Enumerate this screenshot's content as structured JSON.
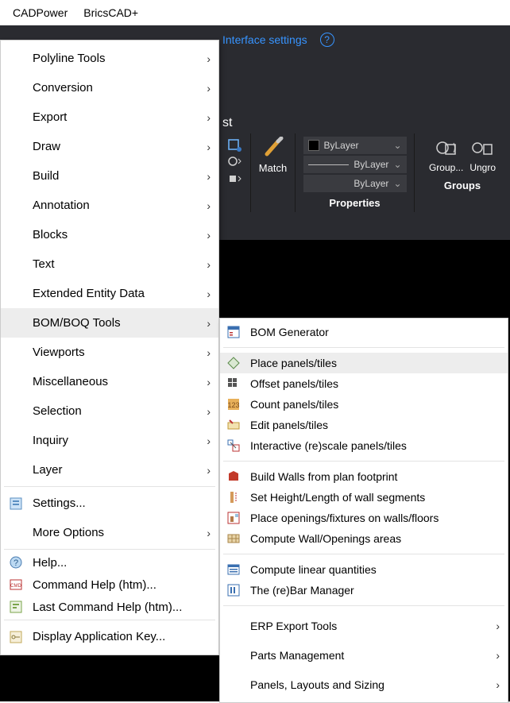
{
  "menubar": {
    "cadpower": "CADPower",
    "bricscad": "BricsCAD+"
  },
  "ribbon": {
    "interface_link": "Interface settings",
    "title_suffix": "st",
    "match": "Match",
    "prop_bylayer": "ByLayer",
    "properties": "Properties",
    "group": "Group...",
    "ungroup": "Ungro",
    "groups": "Groups"
  },
  "menu1": {
    "polyline": "Polyline Tools",
    "conversion": "Conversion",
    "export": "Export",
    "draw": "Draw",
    "build": "Build",
    "annotation": "Annotation",
    "blocks": "Blocks",
    "text": "Text",
    "extended": "Extended Entity Data",
    "bom": "BOM/BOQ Tools",
    "viewports": "Viewports",
    "misc": "Miscellaneous",
    "selection": "Selection",
    "inquiry": "Inquiry",
    "layer": "Layer",
    "settings": "Settings...",
    "more": "More Options",
    "help": "Help...",
    "cmdhelp": "Command Help (htm)...",
    "lastcmdhelp": "Last Command Help (htm)...",
    "appkey": "Display Application Key..."
  },
  "menu2": {
    "bomgen": "BOM Generator",
    "place": "Place panels/tiles",
    "offset": "Offset panels/tiles",
    "count": "Count panels/tiles",
    "edit": "Edit panels/tiles",
    "rescale": "Interactive (re)scale panels/tiles",
    "walls": "Build Walls from plan footprint",
    "height": "Set Height/Length of wall segments",
    "openings": "Place openings/fixtures on walls/floors",
    "compute_wall": "Compute Wall/Openings areas",
    "linear": "Compute linear quantities",
    "rebar": "The (re)Bar Manager",
    "erp": "ERP Export Tools",
    "parts": "Parts Management",
    "layouts": "Panels, Layouts and Sizing"
  }
}
